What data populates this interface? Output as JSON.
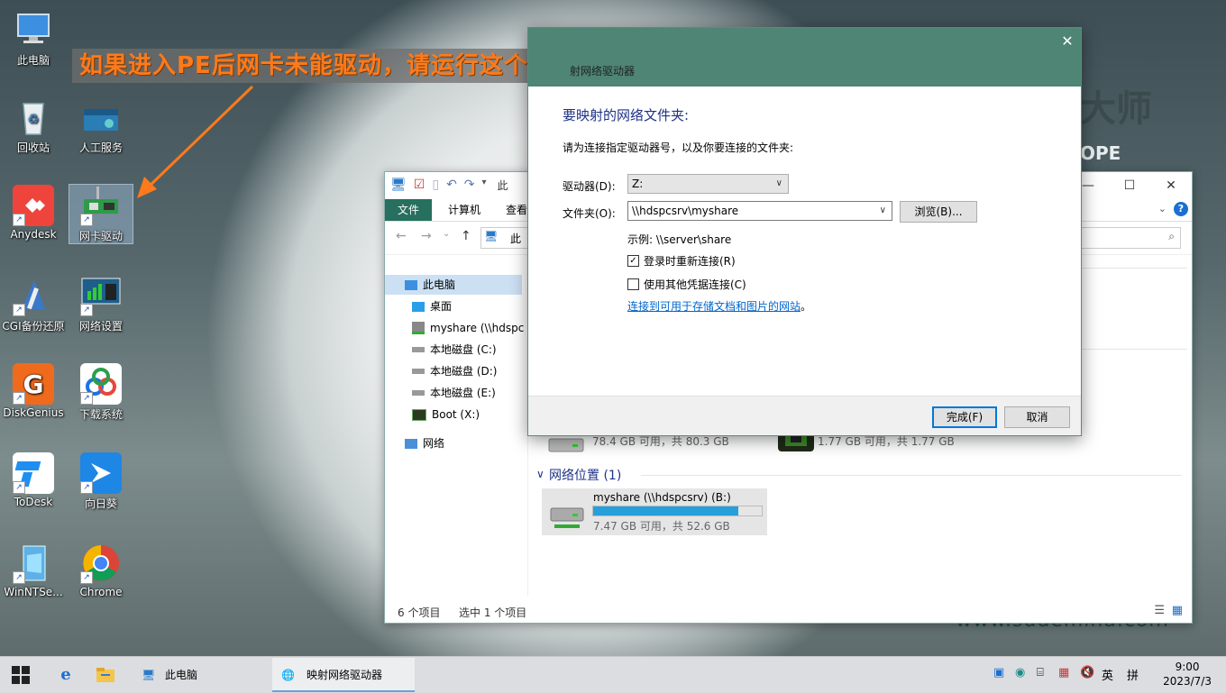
{
  "desktop": {
    "banner": "如果进入PE后网卡未能驱动，请运行这个。",
    "wallpaper_text_1": "大师",
    "wallpaper_text_2": "OPE",
    "wallpaper_site": "www.sudemina.com",
    "icons": [
      {
        "label": "此电脑"
      },
      {
        "label": "回收站"
      },
      {
        "label": "Anydesk"
      },
      {
        "label": "CGI备份还原"
      },
      {
        "label": "DiskGenius"
      },
      {
        "label": "ToDesk"
      },
      {
        "label": "WinNTSe..."
      },
      {
        "label": "人工服务"
      },
      {
        "label": "网卡驱动"
      },
      {
        "label": "网络设置"
      },
      {
        "label": "下载系统"
      },
      {
        "label": "向日葵"
      },
      {
        "label": "Chrome"
      }
    ]
  },
  "explorer": {
    "tabs": {
      "file": "文件",
      "computer": "计算机",
      "view": "查看"
    },
    "address_fragment": "此",
    "title_fragment": "此",
    "nav": {
      "this_pc": "此电脑",
      "desktop": "桌面",
      "myshare": "myshare (\\\\hdspc",
      "c": "本地磁盘 (C:)",
      "d": "本地磁盘 (D:)",
      "e": "本地磁盘 (E:)",
      "boot": "Boot (X:)",
      "network": "网络"
    },
    "drives": {
      "d1_size": "78.4 GB 可用，共 80.3 GB",
      "d1_fill": 0.02,
      "d2_size": "1.77 GB 可用，共 1.77 GB",
      "d2_fill": 0.0
    },
    "network_group": "网络位置 (1)",
    "share": {
      "name": "myshare (\\\\hdspcsrv) (B:)",
      "size": "7.47 GB 可用，共 52.6 GB",
      "fill": 0.86
    },
    "status": {
      "items": "6 个项目",
      "selected": "选中 1 个项目"
    }
  },
  "dialog": {
    "title": "射网络驱动器",
    "heading": "要映射的网络文件夹:",
    "desc": "请为连接指定驱动器号，以及你要连接的文件夹:",
    "drive_label": "驱动器(D):",
    "drive_value": "Z:",
    "folder_label": "文件夹(O):",
    "folder_value": "\\\\hdspcsrv\\myshare",
    "browse": "浏览(B)...",
    "example": "示例: \\\\server\\share",
    "reconnect": "登录时重新连接(R)",
    "reconnect_checked": true,
    "other_cred": "使用其他凭据连接(C)",
    "other_cred_checked": false,
    "link": "连接到可用于存储文档和图片的网站",
    "link_suffix": "。",
    "finish": "完成(F)",
    "cancel": "取消"
  },
  "taskbar": {
    "tasks": [
      {
        "label": "此电脑"
      },
      {
        "label": "映射网络驱动器"
      }
    ],
    "ime": "英",
    "ime2": "拼",
    "time": "9:00",
    "date": "2023/7/3"
  },
  "colors": {
    "accent": "#4e8575",
    "file_tab": "#276f5e",
    "link": "#0066cc",
    "heading": "#1e3287",
    "bar_fill": "#26a0da",
    "banner_text": "#ff7a1a"
  }
}
